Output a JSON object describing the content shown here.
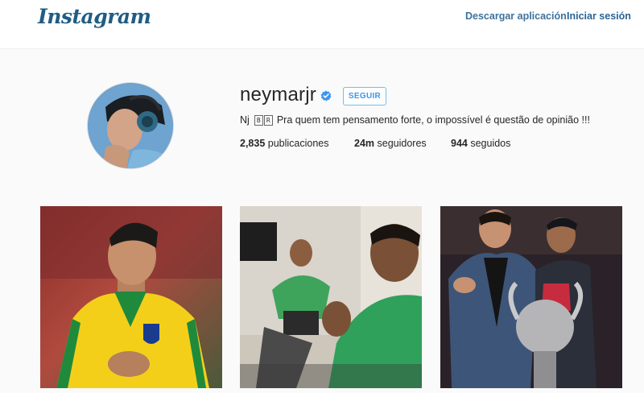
{
  "header": {
    "logo": "Instagram",
    "download_link": "Descargar aplicación",
    "login_link": "Iniciar sesión"
  },
  "profile": {
    "username": "neymarjr",
    "verified": true,
    "follow_button": "SEGUIR",
    "bio_prefix": "Nj",
    "bio_flag": [
      "B",
      "R"
    ],
    "bio_text": "Pra quem tem pensamento forte, o impossível é questão de opinião !!!",
    "stats": {
      "posts_count": "2,835",
      "posts_label": "publicaciones",
      "followers_count": "24m",
      "followers_label": "seguidores",
      "following_count": "944",
      "following_label": "seguidos"
    }
  },
  "colors": {
    "brand": "#1f5d84",
    "link": "#3f729b",
    "follow_blue": "#3897f0",
    "verified_blue": "#3897f0"
  },
  "icons": {
    "verified": "verified-badge-icon"
  }
}
